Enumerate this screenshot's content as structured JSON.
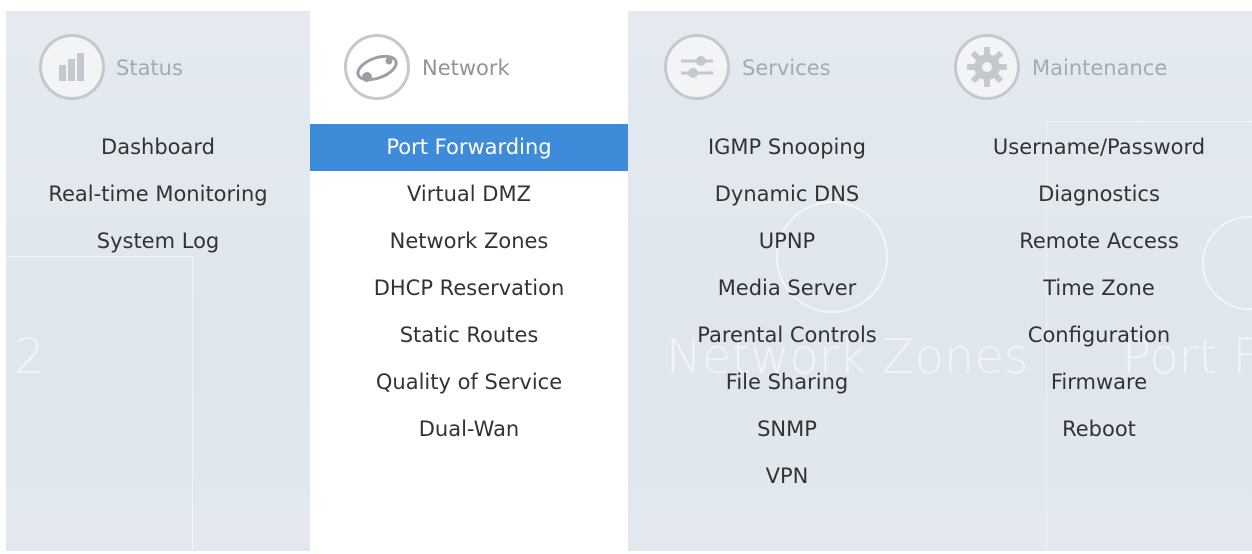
{
  "menu": {
    "columns": [
      {
        "title": "Status",
        "icon": "bar-chart-icon",
        "items": [
          "Dashboard",
          "Real-time Monitoring",
          "System Log"
        ]
      },
      {
        "title": "Network",
        "icon": "network-icon",
        "active": true,
        "selected_item": "Port Forwarding",
        "items": [
          "Port Forwarding",
          "Virtual DMZ",
          "Network Zones",
          "DHCP Reservation",
          "Static Routes",
          "Quality of Service",
          "Dual-Wan"
        ]
      },
      {
        "title": "Services",
        "icon": "sliders-icon",
        "items": [
          "IGMP Snooping",
          "Dynamic DNS",
          "UPNP",
          "Media Server",
          "Parental Controls",
          "File Sharing",
          "SNMP",
          "VPN"
        ]
      },
      {
        "title": "Maintenance",
        "icon": "gear-icon",
        "items": [
          "Username/Password",
          "Diagnostics",
          "Remote Access",
          "Time Zone",
          "Configuration",
          "Firmware",
          "Reboot"
        ]
      }
    ]
  },
  "background": {
    "text_network_zones": "Network Zones",
    "text_port_f": "Port F",
    "text_2": "2"
  },
  "colors": {
    "selected": "#3d8bd9",
    "menu_bg": "#e0e7ee",
    "active_bg": "#ffffff"
  }
}
